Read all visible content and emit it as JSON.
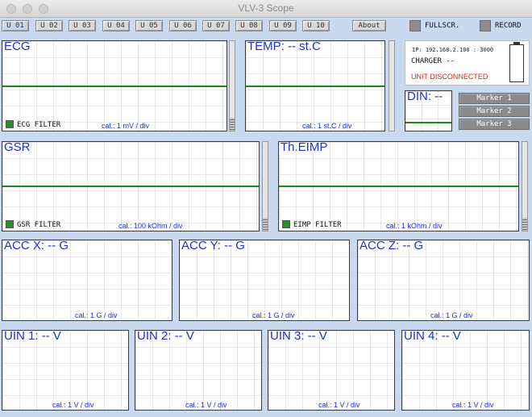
{
  "window": {
    "title": "VLV-3 Scope"
  },
  "toolbar": {
    "unit_buttons": [
      "U 01",
      "U 02",
      "U 03",
      "U 04",
      "U 05",
      "U 06",
      "U 07",
      "U 08",
      "U 09",
      "U 10"
    ],
    "about_label": "About",
    "fullscreen_label": "FULLSCR.",
    "record_label": "RECORD"
  },
  "status": {
    "ip": "IP: 192.168.2.100 : 3000",
    "charger": "CHARGER --",
    "connection": "UNIT DISCONNECTED",
    "connection_color": "#e02020"
  },
  "panels": {
    "ecg": {
      "title": "ECG",
      "cal": "cal.: 1 mV / div",
      "filter": "ECG FILTER"
    },
    "temp": {
      "title": "TEMP: -- st.C",
      "cal": "cal.: 1 st.C / div"
    },
    "din": {
      "title": "DIN: --"
    },
    "gsr": {
      "title": "GSR",
      "cal": "cal.: 100 kOhm / div",
      "filter": "GSR FILTER"
    },
    "eimp": {
      "title": "Th.EIMP",
      "cal": "cal.: 1 kOhm / div",
      "filter": "EIMP FILTER"
    },
    "accx": {
      "title": "ACC X: -- G",
      "cal": "cal.: 1 G / div"
    },
    "accy": {
      "title": "ACC Y: -- G",
      "cal": "cal.: 1 G / div"
    },
    "accz": {
      "title": "ACC Z: -- G",
      "cal": "cal.: 1 G / div"
    },
    "uin1": {
      "title": "UIN 1: -- V",
      "cal": "cal.: 1 V / div"
    },
    "uin2": {
      "title": "UIN 2: -- V",
      "cal": "cal.: 1 V / div"
    },
    "uin3": {
      "title": "UIN 3: -- V",
      "cal": "cal.: 1 V / div"
    },
    "uin4": {
      "title": "UIN 4: -- V",
      "cal": "cal.: 1 V / div"
    }
  },
  "markers": [
    "Marker 1",
    "Marker 2",
    "Marker 3"
  ],
  "colors": {
    "trace": "#1a8a1a",
    "label_blue": "#1f2fd6",
    "background": "#c9d9f0"
  }
}
